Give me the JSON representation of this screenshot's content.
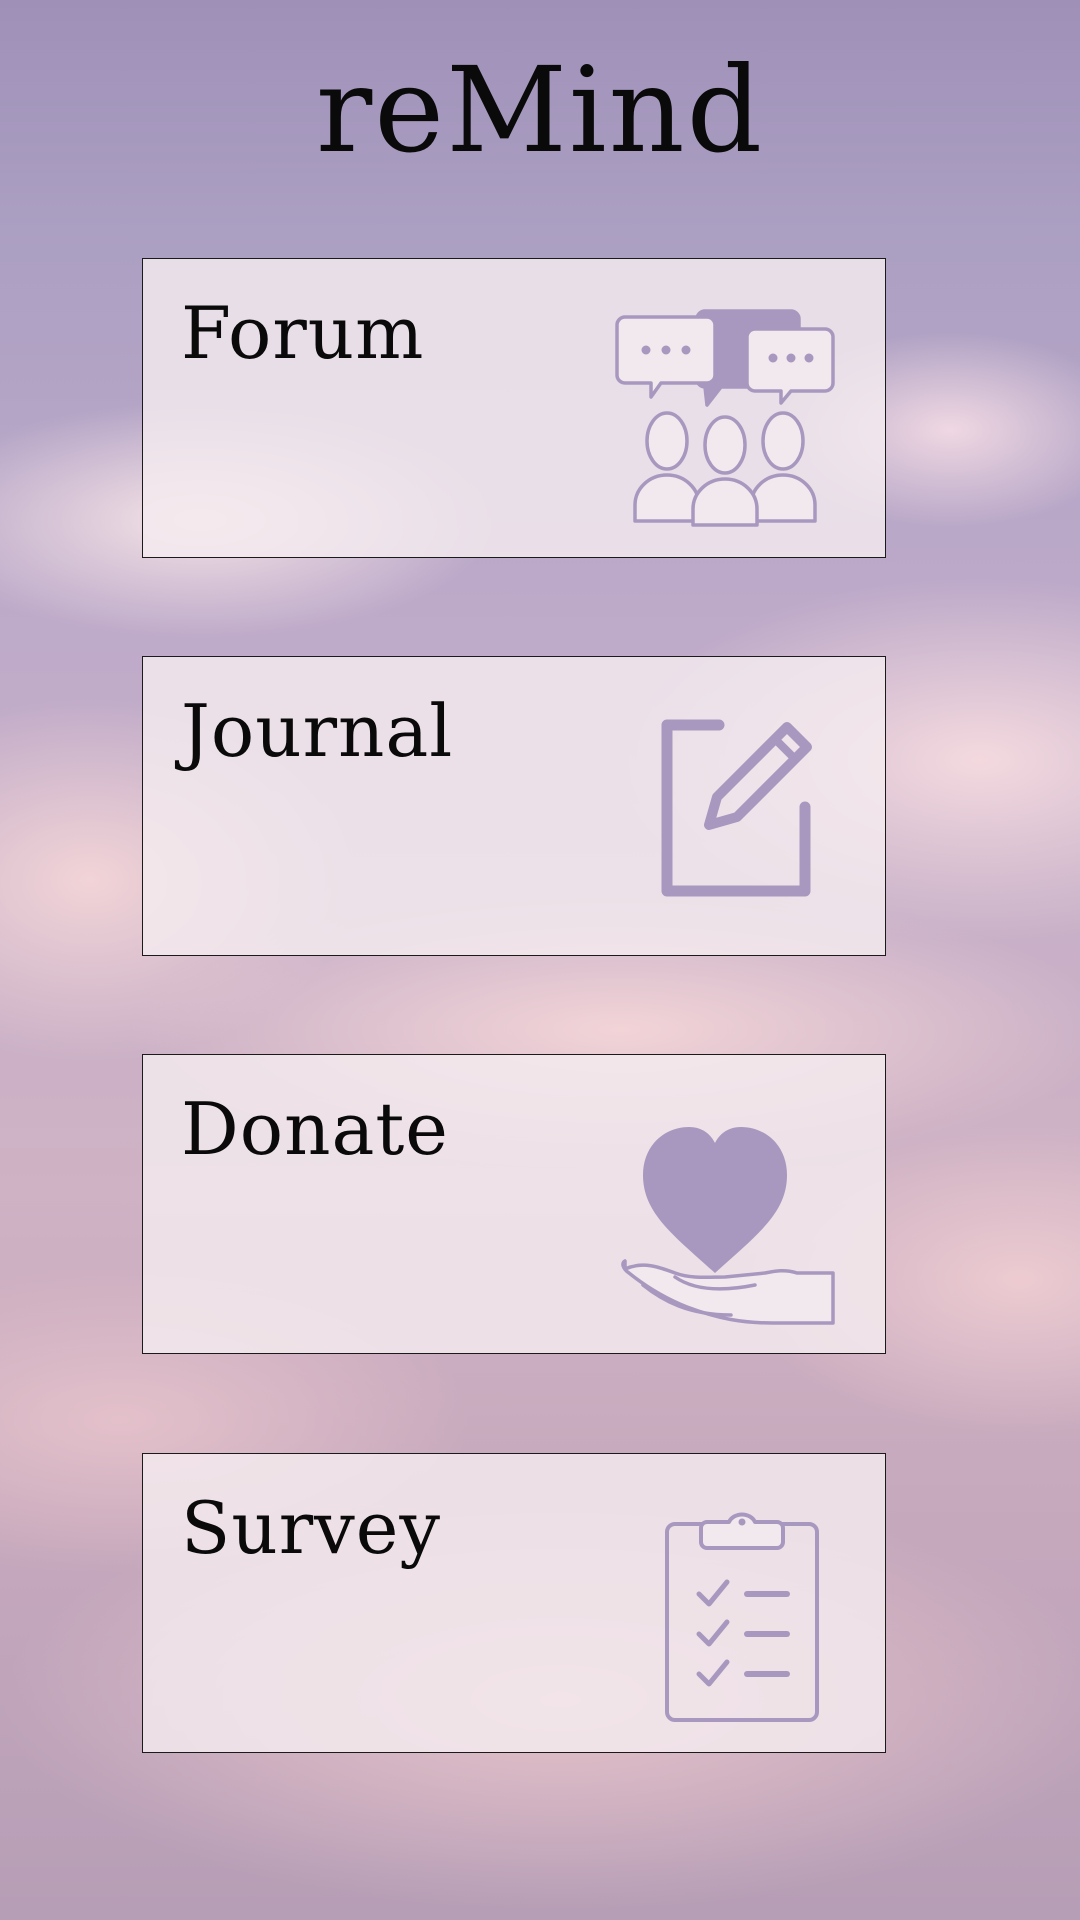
{
  "app": {
    "title": "reMind"
  },
  "menu": {
    "items": [
      {
        "label": "Forum",
        "icon": "group-chat-icon"
      },
      {
        "label": "Journal",
        "icon": "edit-note-icon"
      },
      {
        "label": "Donate",
        "icon": "heart-in-hand-icon"
      },
      {
        "label": "Survey",
        "icon": "checklist-clipboard-icon"
      }
    ]
  },
  "colors": {
    "icon": "#a898bf",
    "card_background": "#f1e9ed",
    "text": "#0a0a0a"
  }
}
